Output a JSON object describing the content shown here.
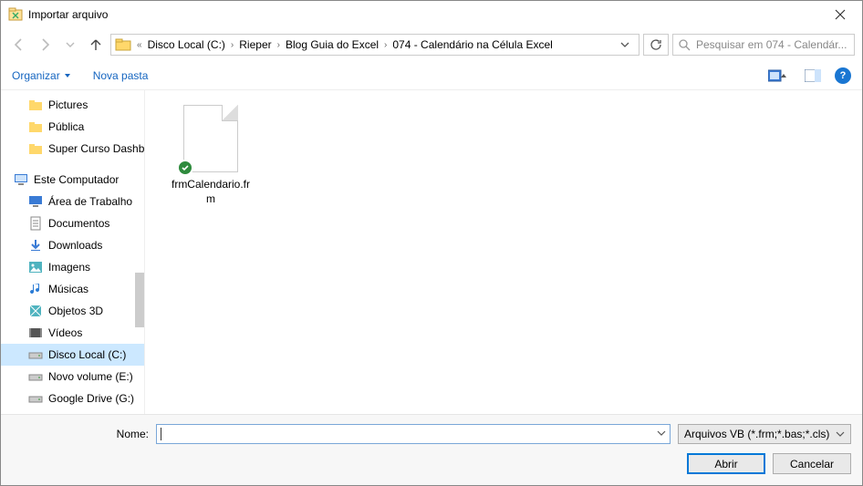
{
  "window": {
    "title": "Importar arquivo"
  },
  "breadcrumb": {
    "prefix": "«",
    "parts": [
      "Disco Local (C:)",
      "Rieper",
      "Blog Guia do Excel",
      "074 - Calendário na Célula Excel"
    ]
  },
  "search": {
    "placeholder": "Pesquisar em 074 - Calendár..."
  },
  "toolbar": {
    "organize": "Organizar",
    "newfolder": "Nova pasta"
  },
  "sidebar": {
    "quick": [
      "Pictures",
      "Pública",
      "Super Curso Dashboards"
    ],
    "computer_label": "Este Computador",
    "computer": [
      {
        "label": "Área de Trabalho",
        "icon": "desktop"
      },
      {
        "label": "Documentos",
        "icon": "doc"
      },
      {
        "label": "Downloads",
        "icon": "down"
      },
      {
        "label": "Imagens",
        "icon": "img"
      },
      {
        "label": "Músicas",
        "icon": "music"
      },
      {
        "label": "Objetos 3D",
        "icon": "obj"
      },
      {
        "label": "Vídeos",
        "icon": "video"
      },
      {
        "label": "Disco Local (C:)",
        "icon": "drive",
        "selected": true
      },
      {
        "label": "Novo volume (E:)",
        "icon": "drive"
      },
      {
        "label": "Google Drive (G:)",
        "icon": "drive"
      }
    ]
  },
  "files": [
    {
      "name": "frmCalendario.frm"
    }
  ],
  "footer": {
    "name_label": "Nome:",
    "name_value": "",
    "filetype": "Arquivos VB (*.frm;*.bas;*.cls)",
    "open": "Abrir",
    "cancel": "Cancelar"
  }
}
